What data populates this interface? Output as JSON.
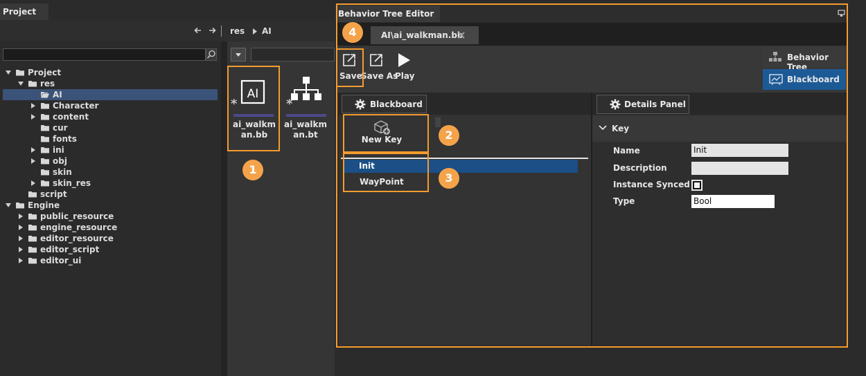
{
  "project": {
    "tab_title": "Project",
    "breadcrumb": [
      "res",
      "AI"
    ],
    "search": {
      "value": "",
      "placeholder": ""
    },
    "tree": [
      {
        "label": "Project",
        "level": 0,
        "expanded": true,
        "has_children": true,
        "selected": false
      },
      {
        "label": "res",
        "level": 1,
        "expanded": true,
        "has_children": true,
        "selected": false
      },
      {
        "label": "AI",
        "level": 2,
        "expanded": false,
        "has_children": false,
        "selected": true,
        "open_folder": true
      },
      {
        "label": "Character",
        "level": 2,
        "expanded": false,
        "has_children": true,
        "selected": false
      },
      {
        "label": "content",
        "level": 2,
        "expanded": false,
        "has_children": true,
        "selected": false
      },
      {
        "label": "cur",
        "level": 2,
        "expanded": false,
        "has_children": false,
        "selected": false
      },
      {
        "label": "fonts",
        "level": 2,
        "expanded": false,
        "has_children": false,
        "selected": false
      },
      {
        "label": "ini",
        "level": 2,
        "expanded": false,
        "has_children": true,
        "selected": false
      },
      {
        "label": "obj",
        "level": 2,
        "expanded": false,
        "has_children": true,
        "selected": false
      },
      {
        "label": "skin",
        "level": 2,
        "expanded": false,
        "has_children": false,
        "selected": false
      },
      {
        "label": "skin_res",
        "level": 2,
        "expanded": false,
        "has_children": true,
        "selected": false
      },
      {
        "label": "script",
        "level": 1,
        "expanded": false,
        "has_children": false,
        "selected": false
      },
      {
        "label": "Engine",
        "level": 0,
        "expanded": true,
        "has_children": true,
        "selected": false
      },
      {
        "label": "public_resource",
        "level": 1,
        "expanded": false,
        "has_children": true,
        "selected": false
      },
      {
        "label": "engine_resource",
        "level": 1,
        "expanded": false,
        "has_children": true,
        "selected": false
      },
      {
        "label": "editor_resource",
        "level": 1,
        "expanded": false,
        "has_children": true,
        "selected": false
      },
      {
        "label": "editor_script",
        "level": 1,
        "expanded": false,
        "has_children": true,
        "selected": false
      },
      {
        "label": "editor_ui",
        "level": 1,
        "expanded": false,
        "has_children": true,
        "selected": false
      }
    ],
    "assets": [
      {
        "name_line1": "ai_walkm",
        "name_line2": "an.bb",
        "icon": "blackboard-file-icon",
        "icon_text": "AI",
        "underline_color": "#4d4a8a"
      },
      {
        "name_line1": "ai_walkm",
        "name_line2": "an.bt",
        "icon": "behavior-tree-file-icon",
        "underline_color": "#4d4a8a"
      }
    ]
  },
  "editor": {
    "title": "Behavior Tree Editor",
    "file_tab": "AI\\ai_walkman.bb",
    "toolbar": {
      "save": "Save",
      "save_as": "Save As",
      "play": "Play"
    },
    "modes": {
      "behavior_tree": "Behavior Tree",
      "blackboard": "Blackboard",
      "active": "Blackboard"
    },
    "blackboard_panel": {
      "title": "Blackboard",
      "new_key": "New Key",
      "keys": [
        {
          "name": "Init",
          "selected": true
        },
        {
          "name": "WayPoint",
          "selected": false
        }
      ]
    },
    "details_panel": {
      "title": "Details Panel",
      "section": "Key",
      "properties": {
        "name_label": "Name",
        "name_value": "Init",
        "description_label": "Description",
        "description_value": "",
        "instance_synced_label": "Instance Synced",
        "instance_synced": true,
        "type_label": "Type",
        "type_value": "Bool"
      }
    }
  },
  "annotations": {
    "color": "#f59c2e",
    "badges": [
      "1",
      "2",
      "3",
      "4"
    ]
  },
  "colors": {
    "selection": "#1b4f86",
    "active_mode": "#1c5a96",
    "tree_selection": "#3b5378"
  }
}
